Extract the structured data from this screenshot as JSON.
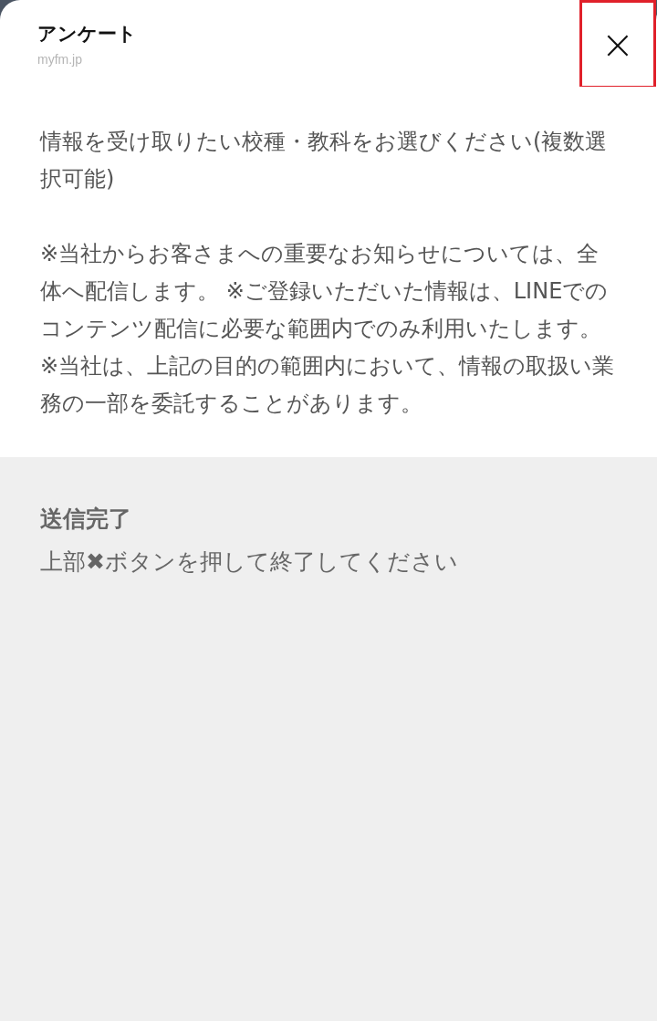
{
  "header": {
    "title": "アンケート",
    "url": "myfm.jp",
    "close_button": {
      "label": "×",
      "highlighted": true
    }
  },
  "description": {
    "intro": "情報を受け取りたい校種・教科をお選びください(複数選択可能)",
    "notes": [
      "※当社からお客さまへの重要なお知らせについては、全体へ配信します。 ※ご登録いただいた情報は、LINEでのコンテンツ配信に必要な範囲内でのみ利用いたします。",
      "※当社は、上記の目的の範囲内において、情報の取扱い業務の一部を委託することがあります。"
    ]
  },
  "completion": {
    "title": "送信完了",
    "message": "上部✖ボタンを押して終了してください"
  }
}
